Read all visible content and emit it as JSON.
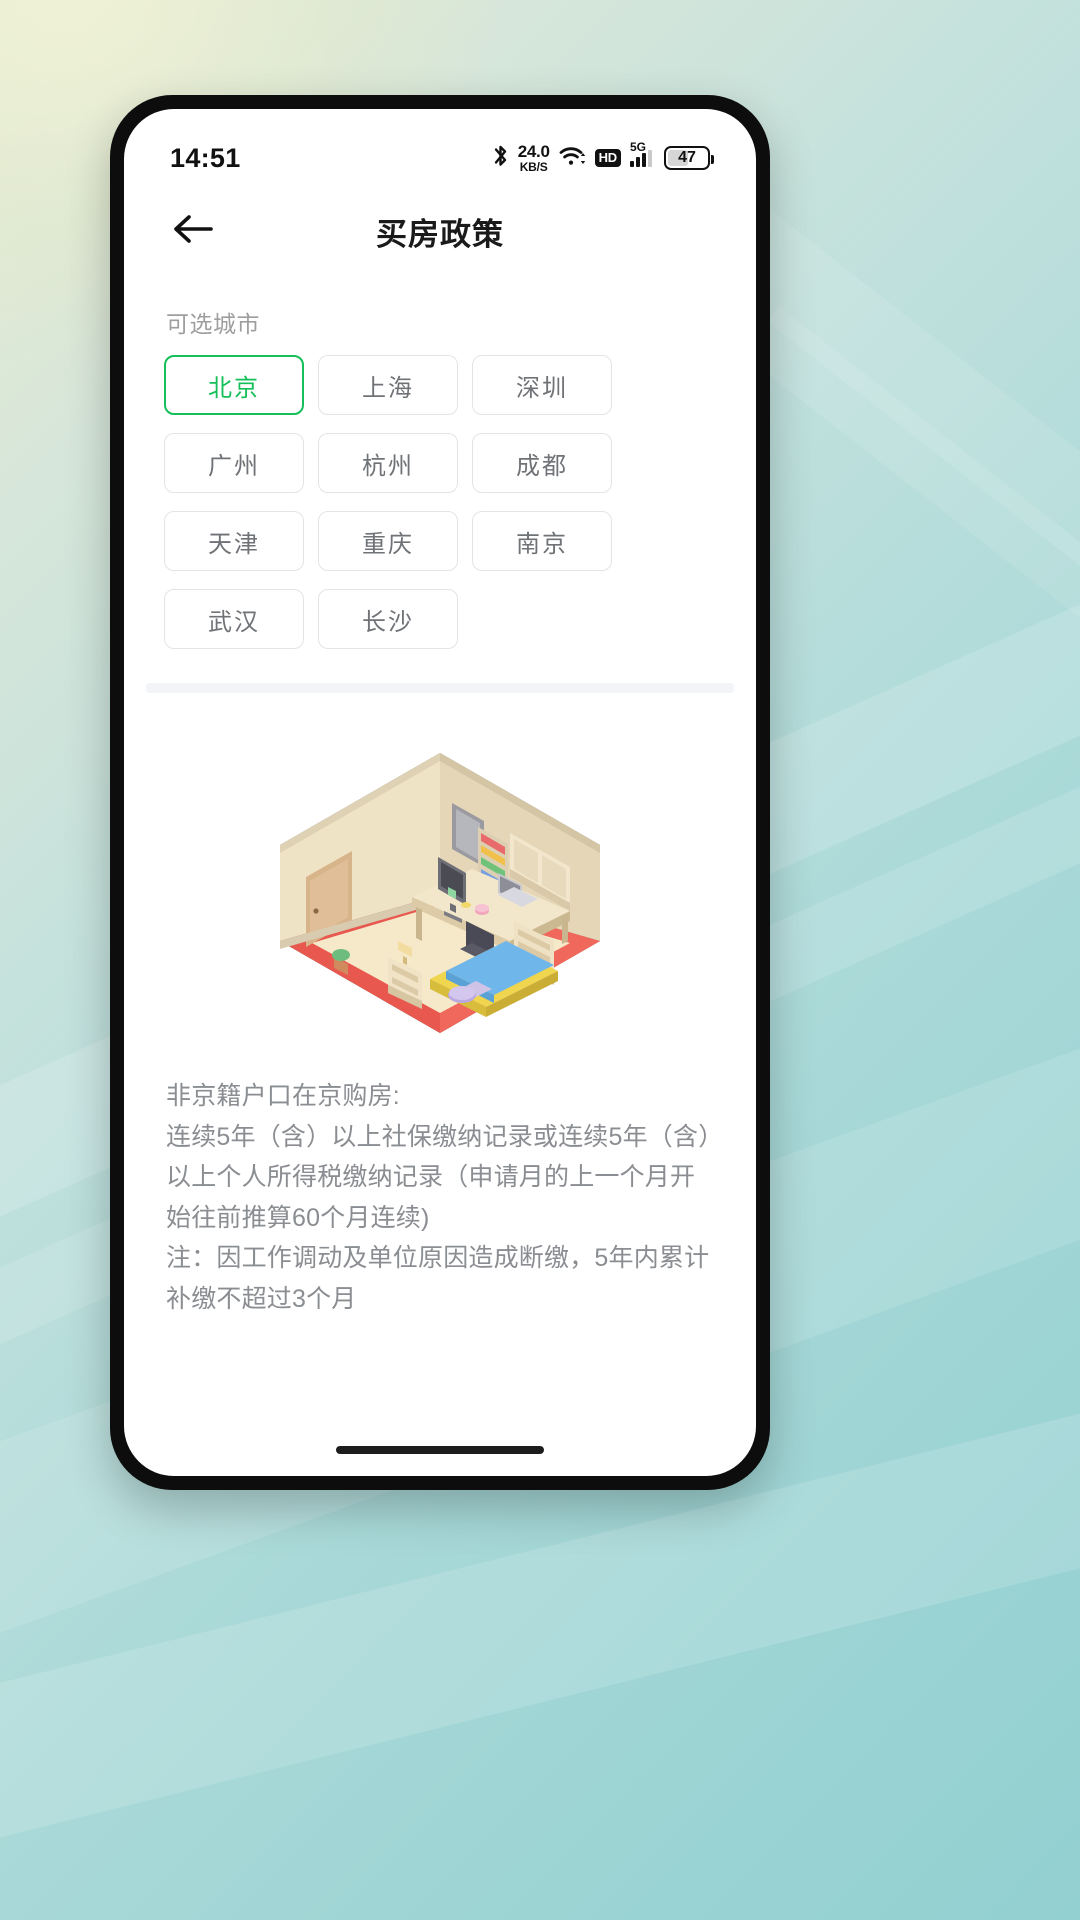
{
  "status_bar": {
    "time": "14:51",
    "bluetooth_icon": "bluetooth-icon",
    "net_rate": "24.0",
    "net_rate_unit": "KB/S",
    "wifi_icon": "wifi-icon",
    "hd_label": "HD",
    "signal_label": "5G",
    "battery_level": "47"
  },
  "header": {
    "back_icon": "back-arrow-icon",
    "title": "买房政策"
  },
  "city_section": {
    "label": "可选城市",
    "selected": "北京",
    "selected_color": "#15c05a",
    "cities": [
      {
        "name": "北京",
        "selected": true
      },
      {
        "name": "上海",
        "selected": false
      },
      {
        "name": "深圳",
        "selected": false
      },
      {
        "name": "广州",
        "selected": false
      },
      {
        "name": "杭州",
        "selected": false
      },
      {
        "name": "成都",
        "selected": false
      },
      {
        "name": "天津",
        "selected": false
      },
      {
        "name": "重庆",
        "selected": false
      },
      {
        "name": "南京",
        "selected": false
      },
      {
        "name": "武汉",
        "selected": false
      },
      {
        "name": "长沙",
        "selected": false
      }
    ]
  },
  "illustration": {
    "name": "isometric-bedroom-illustration",
    "alt": "等距卧室插图"
  },
  "policy": {
    "body": "非京籍户口在京购房:\n连续5年（含）以上社保缴纳记录或连续5年（含）以上个人所得税缴纳记录（申请月的上一个月开始往前推算60个月连续)\n注：因工作调动及单位原因造成断缴，5年内累计补缴不超过3个月"
  },
  "home_indicator": "home-indicator"
}
